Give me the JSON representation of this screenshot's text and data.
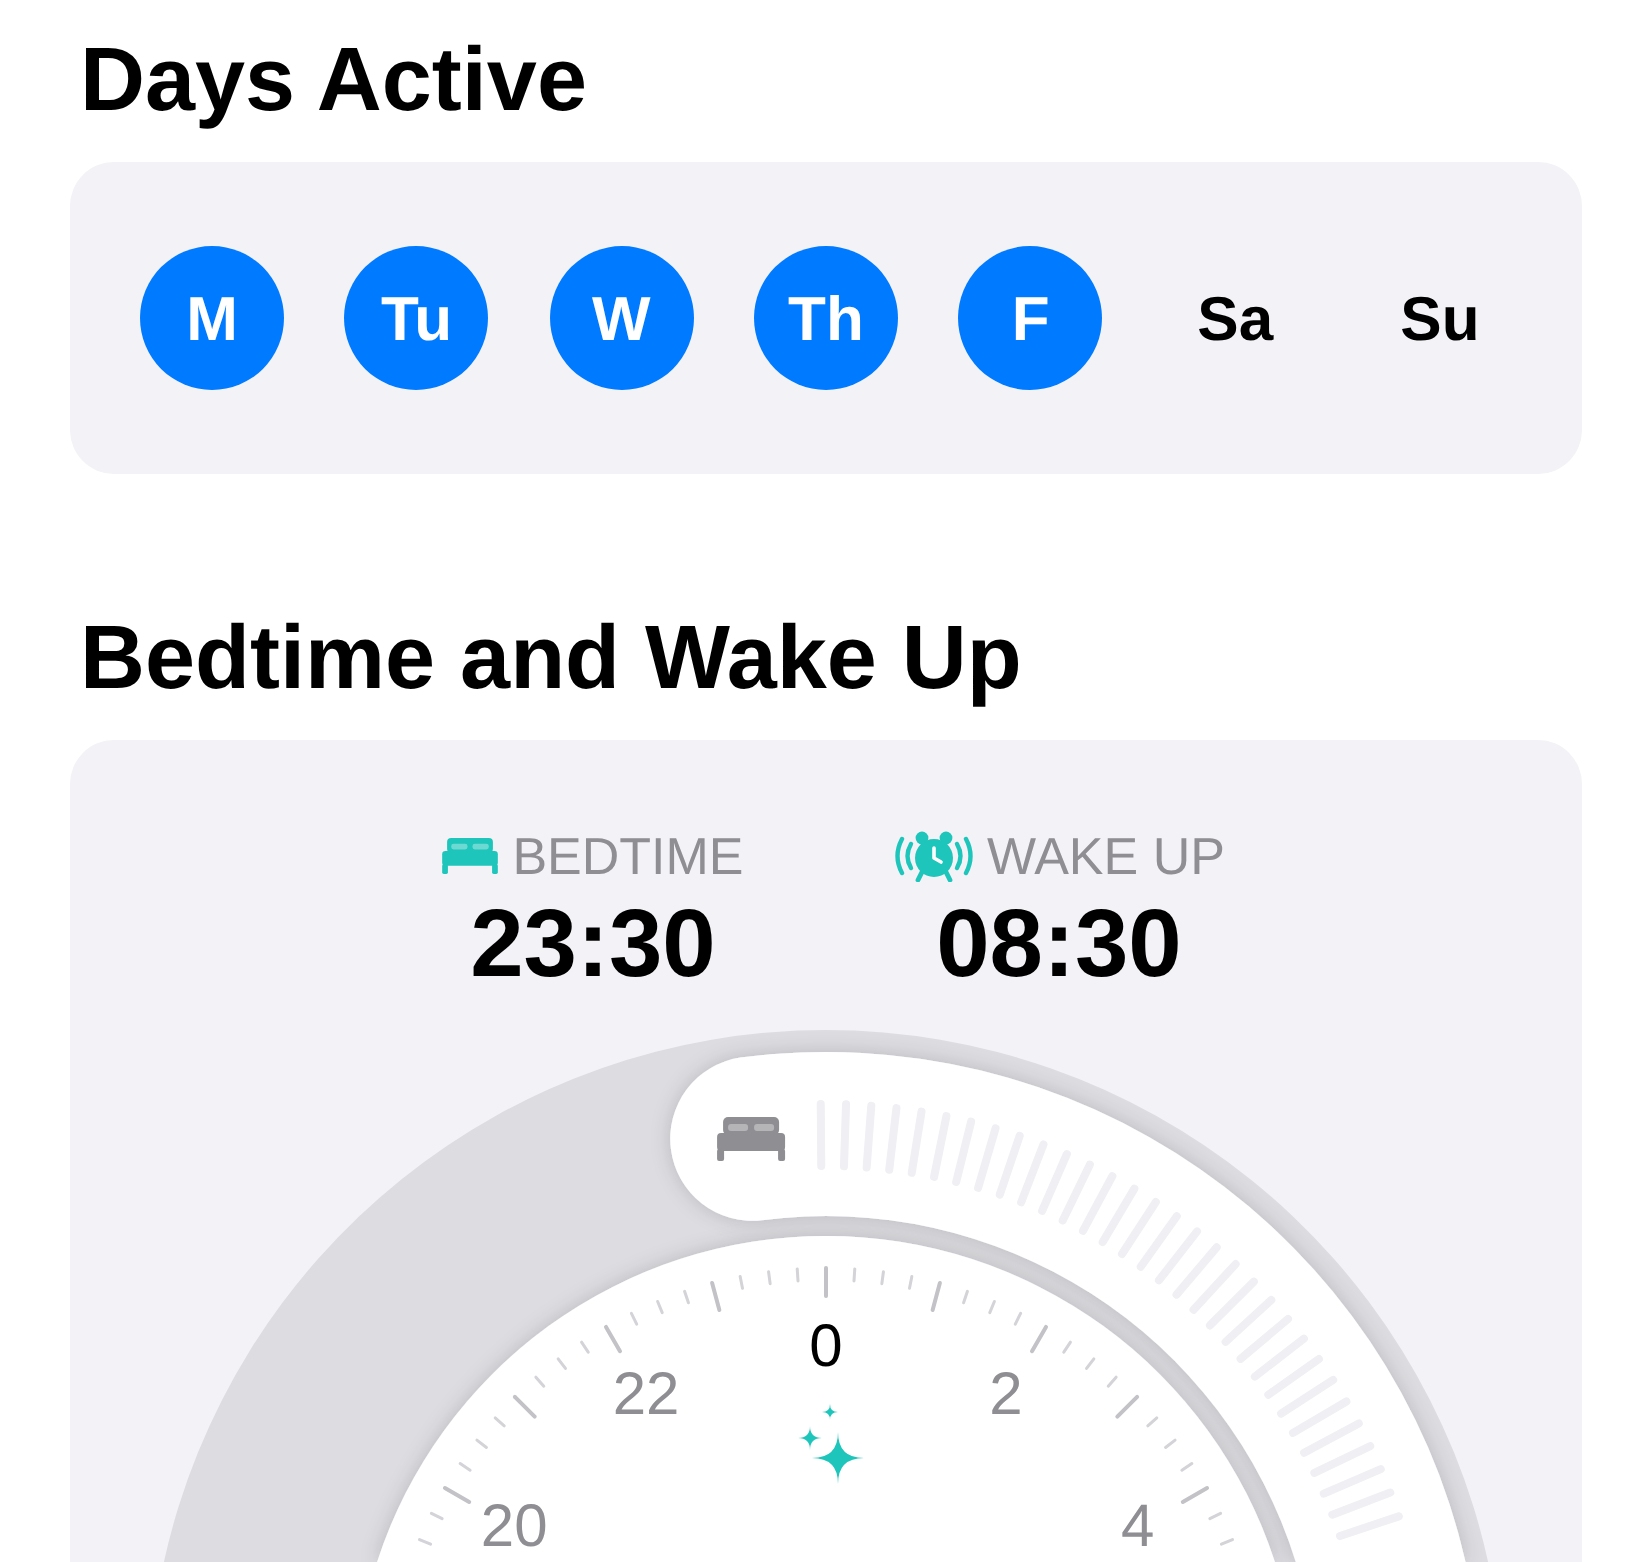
{
  "days_active": {
    "title": "Days Active",
    "days": [
      {
        "label": "M",
        "selected": true
      },
      {
        "label": "Tu",
        "selected": true
      },
      {
        "label": "W",
        "selected": true
      },
      {
        "label": "Th",
        "selected": true
      },
      {
        "label": "F",
        "selected": true
      },
      {
        "label": "Sa",
        "selected": false
      },
      {
        "label": "Su",
        "selected": false
      }
    ]
  },
  "schedule": {
    "title": "Bedtime and Wake Up",
    "times": [
      {
        "kind": "bedtime",
        "label": "BEDTIME",
        "value": "23:30"
      },
      {
        "kind": "wake",
        "label": "WAKE UP",
        "value": "08:30"
      }
    ],
    "dial": {
      "hour_labels": [
        {
          "label": "20",
          "kind": "minor"
        },
        {
          "label": "22",
          "kind": "minor"
        },
        {
          "label": "0",
          "kind": "major"
        },
        {
          "label": "2",
          "kind": "minor"
        },
        {
          "label": "4",
          "kind": "minor"
        }
      ]
    }
  }
}
